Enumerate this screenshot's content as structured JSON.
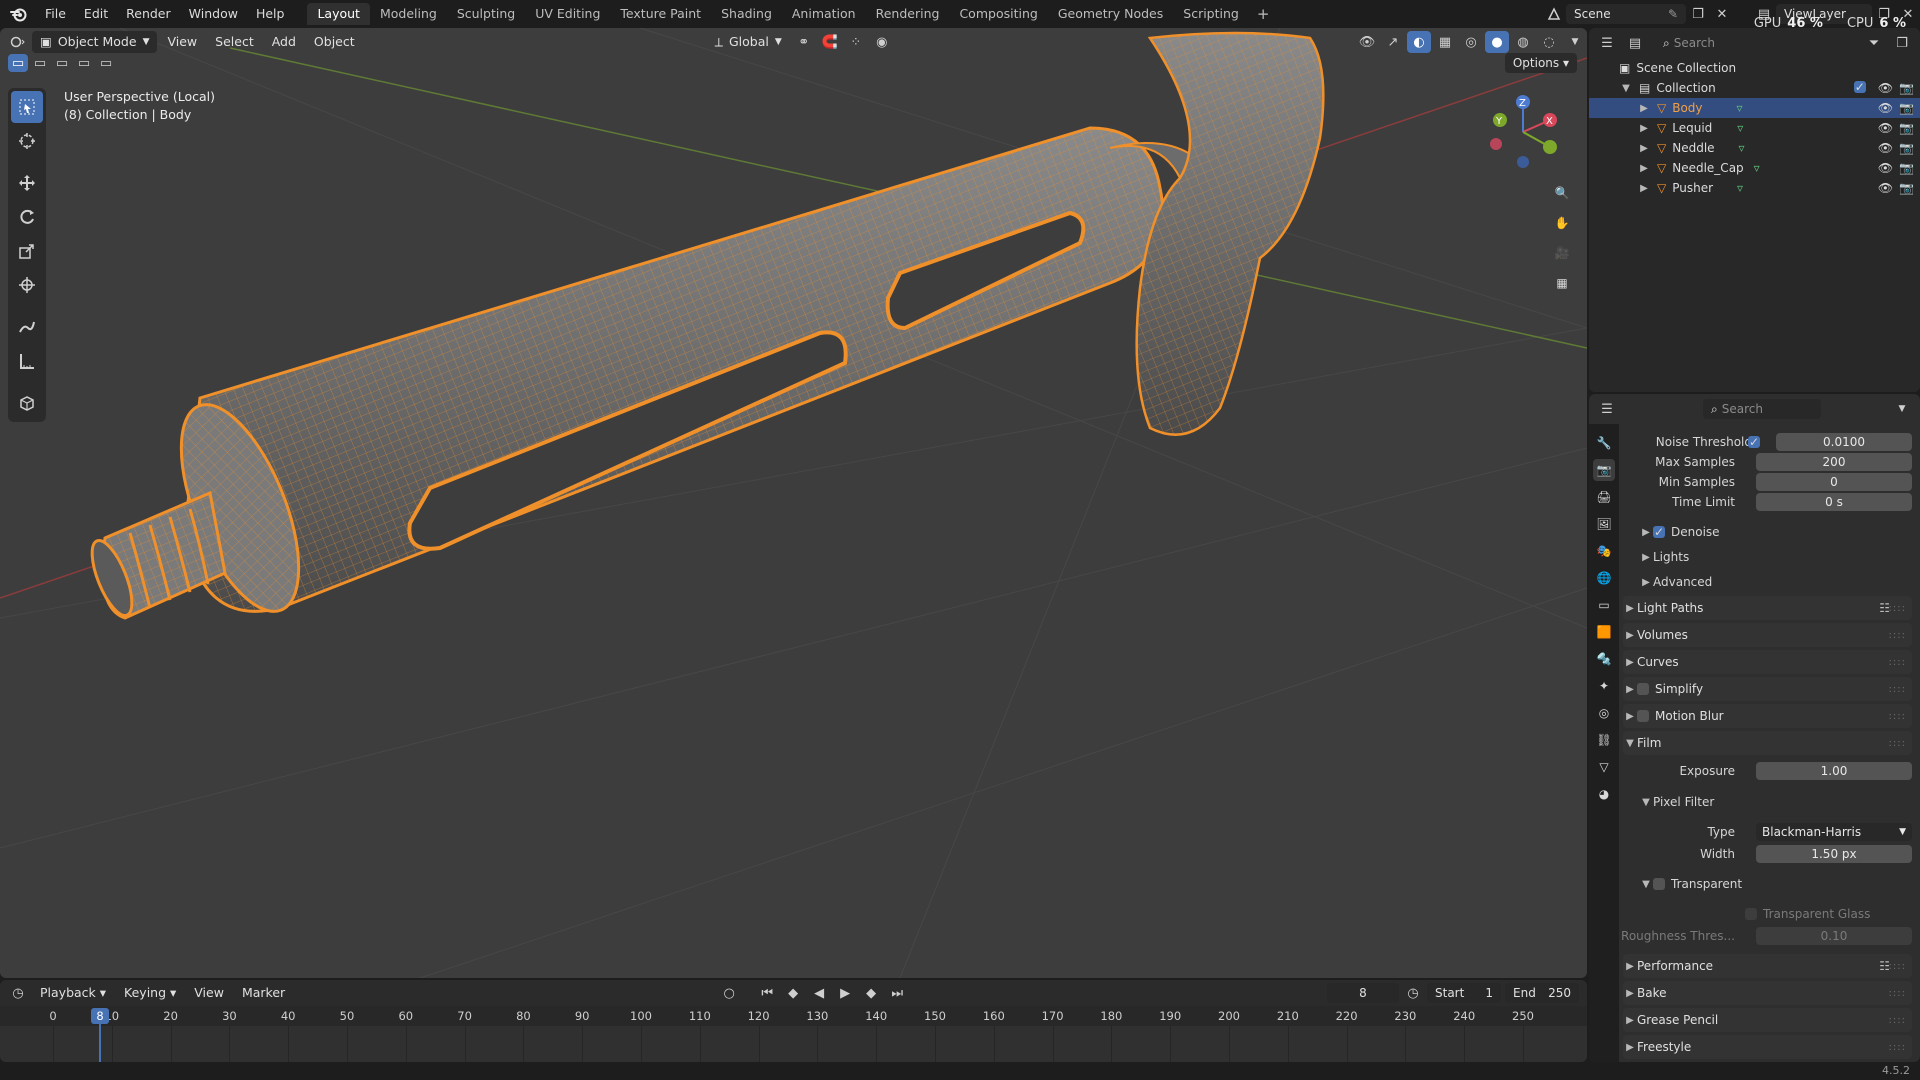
{
  "topbar": {
    "menus": [
      "File",
      "Edit",
      "Render",
      "Window",
      "Help"
    ],
    "workspaces": [
      "Layout",
      "Modeling",
      "Sculpting",
      "UV Editing",
      "Texture Paint",
      "Shading",
      "Animation",
      "Rendering",
      "Compositing",
      "Geometry Nodes",
      "Scripting"
    ],
    "active_workspace": "Layout",
    "scene": "Scene",
    "view_layer": "ViewLayer",
    "gpu_label": "GPU",
    "gpu_value": "46 %",
    "cpu_label": "CPU",
    "cpu_value": "6 %"
  },
  "viewport": {
    "mode": "Object Mode",
    "menus": [
      "View",
      "Select",
      "Add",
      "Object"
    ],
    "transform_orientation": "Global",
    "options_label": "Options",
    "overlay_line1": "User Perspective (Local)",
    "overlay_line2": "(8) Collection | Body",
    "accent_color": "#f0902a"
  },
  "outliner": {
    "search_placeholder": "Search",
    "scene_collection": "Scene Collection",
    "collection": "Collection",
    "objects": [
      "Body",
      "Lequid",
      "Neddle",
      "Needle_Cap",
      "Pusher"
    ],
    "selected": "Body"
  },
  "properties": {
    "search_placeholder": "Search",
    "noise_threshold_label": "Noise Threshold",
    "noise_threshold": "0.0100",
    "max_samples_label": "Max Samples",
    "max_samples": "200",
    "min_samples_label": "Min Samples",
    "min_samples": "0",
    "time_limit_label": "Time Limit",
    "time_limit": "0 s",
    "denoise": "Denoise",
    "lights": "Lights",
    "advanced": "Advanced",
    "light_paths": "Light Paths",
    "volumes": "Volumes",
    "curves": "Curves",
    "simplify": "Simplify",
    "motion_blur": "Motion Blur",
    "film": "Film",
    "exposure_label": "Exposure",
    "exposure": "1.00",
    "pixel_filter": "Pixel Filter",
    "type_label": "Type",
    "type_value": "Blackman-Harris",
    "width_label": "Width",
    "width_value": "1.50 px",
    "transparent": "Transparent",
    "transparent_glass": "Transparent Glass",
    "roughness_label": "Roughness Thres...",
    "roughness_value": "0.10",
    "performance": "Performance",
    "bake": "Bake",
    "grease_pencil": "Grease Pencil",
    "freestyle": "Freestyle"
  },
  "timeline": {
    "menus": [
      "Playback",
      "Keying",
      "View",
      "Marker"
    ],
    "current_frame": "8",
    "start_label": "Start",
    "start": "1",
    "end_label": "End",
    "end": "250",
    "ticks": [
      "0",
      "10",
      "20",
      "30",
      "40",
      "50",
      "60",
      "70",
      "80",
      "90",
      "100",
      "110",
      "120",
      "130",
      "140",
      "150",
      "160",
      "170",
      "180",
      "190",
      "200",
      "210",
      "220",
      "230",
      "240",
      "250"
    ]
  },
  "status": {
    "version": "4.5.2"
  }
}
